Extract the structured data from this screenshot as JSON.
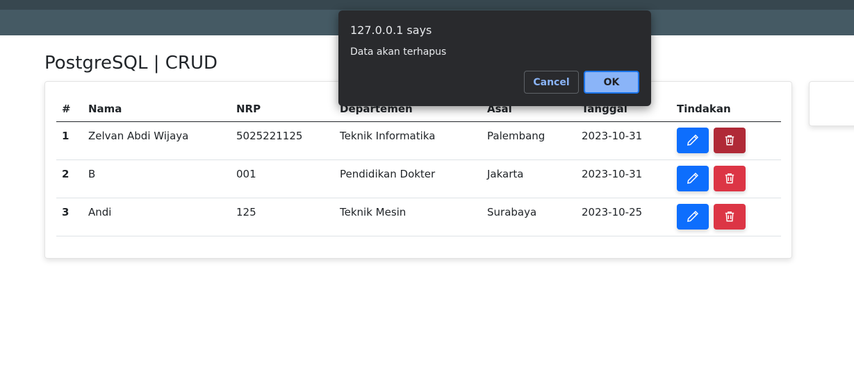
{
  "page": {
    "title": "PostgreSQL | CRUD"
  },
  "table": {
    "headers": [
      "#",
      "Nama",
      "NRP",
      "Departemen",
      "Asal",
      "Tanggal",
      "Tindakan"
    ],
    "rows": [
      {
        "no": "1",
        "nama": "Zelvan Abdi Wijaya",
        "nrp": "5025221125",
        "departemen": "Teknik Informatika",
        "asal": "Palembang",
        "tanggal": "2023-10-31"
      },
      {
        "no": "2",
        "nama": "B",
        "nrp": "001",
        "departemen": "Pendidikan Dokter",
        "asal": "Jakarta",
        "tanggal": "2023-10-31"
      },
      {
        "no": "3",
        "nama": "Andi",
        "nrp": "125",
        "departemen": "Teknik Mesin",
        "asal": "Surabaya",
        "tanggal": "2023-10-25"
      }
    ],
    "actions": {
      "edit_icon": "pencil-icon",
      "delete_icon": "trash-icon"
    }
  },
  "dialog": {
    "title": "127.0.0.1 says",
    "message": "Data akan terhapus",
    "cancel_label": "Cancel",
    "ok_label": "OK"
  },
  "colors": {
    "navbar": "#455a64",
    "edit_button": "#0d6efd",
    "delete_button": "#dc3545",
    "dialog_bg": "#292a2d",
    "dialog_ok": "#8ab4f8"
  }
}
